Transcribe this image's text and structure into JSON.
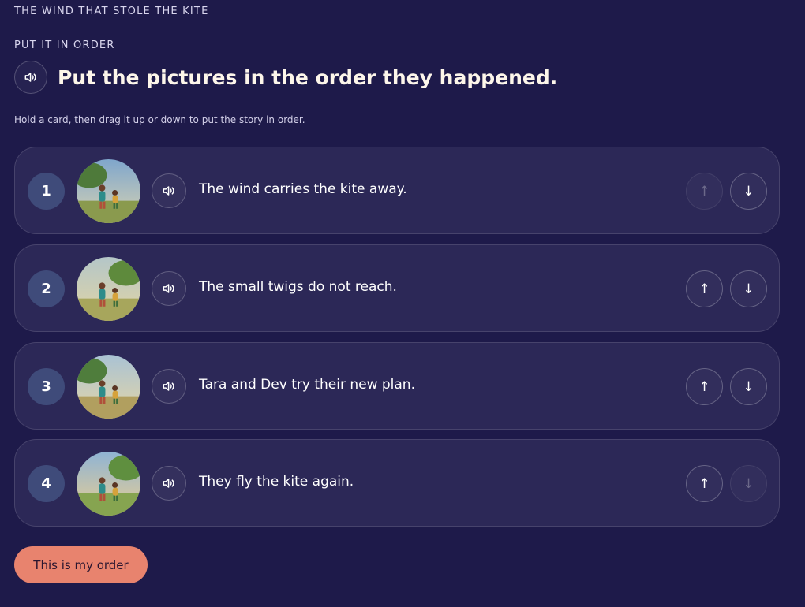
{
  "header": {
    "story_title": "THE WIND THAT STOLE THE KITE",
    "activity_label": "PUT IT IN ORDER",
    "prompt": "Put the pictures in the order they happened.",
    "prompt_audio_icon": "speaker-icon"
  },
  "instruction": "Hold a card, then drag it up or down to put the story in order.",
  "cards": [
    {
      "number": "1",
      "text": "The wind carries the kite away.",
      "up_enabled": false,
      "down_enabled": true
    },
    {
      "number": "2",
      "text": "The small twigs do not reach.",
      "up_enabled": true,
      "down_enabled": true
    },
    {
      "number": "3",
      "text": "Tara and Dev try their new plan.",
      "up_enabled": true,
      "down_enabled": true
    },
    {
      "number": "4",
      "text": "They fly the kite again.",
      "up_enabled": true,
      "down_enabled": false
    }
  ],
  "move_up_glyph": "↑",
  "move_down_glyph": "↓",
  "submit_label": "This is my order",
  "colors": {
    "background": "#1e1a4a",
    "card": "#2c2857",
    "badge": "#3f4b7a",
    "accent": "#e8836e"
  }
}
